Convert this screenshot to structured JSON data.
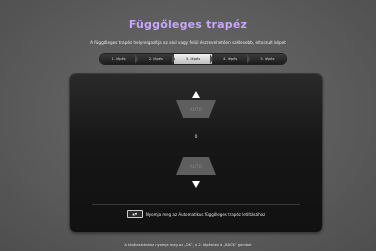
{
  "title": "Függőleges trapéz",
  "subtitle": "A függőleges trapéz helyreigazítja az alul vagy felül észrevehetően szélesebb, eltorzult képet",
  "steps": [
    {
      "label": "1. lépés",
      "active": false
    },
    {
      "label": "2. lépés",
      "active": false
    },
    {
      "label": "3. lépés",
      "active": true
    },
    {
      "label": "4. lépés",
      "active": false
    },
    {
      "label": "5. lépés",
      "active": false
    }
  ],
  "panel": {
    "top_trap_label": "AUTO",
    "bottom_trap_label": "AUTO",
    "value": "0",
    "hint_key": "▲▼",
    "hint_text": "Nyomja meg az Automatikus függőleges trapéz letiltásához"
  },
  "footer": "A kiválasztáshoz nyomja meg az „OK”, a 2. lépéshez a „BACK” gombot",
  "colors": {
    "title": "#c8a6ff",
    "background": "#5a5a5a",
    "panel": "#161616"
  }
}
